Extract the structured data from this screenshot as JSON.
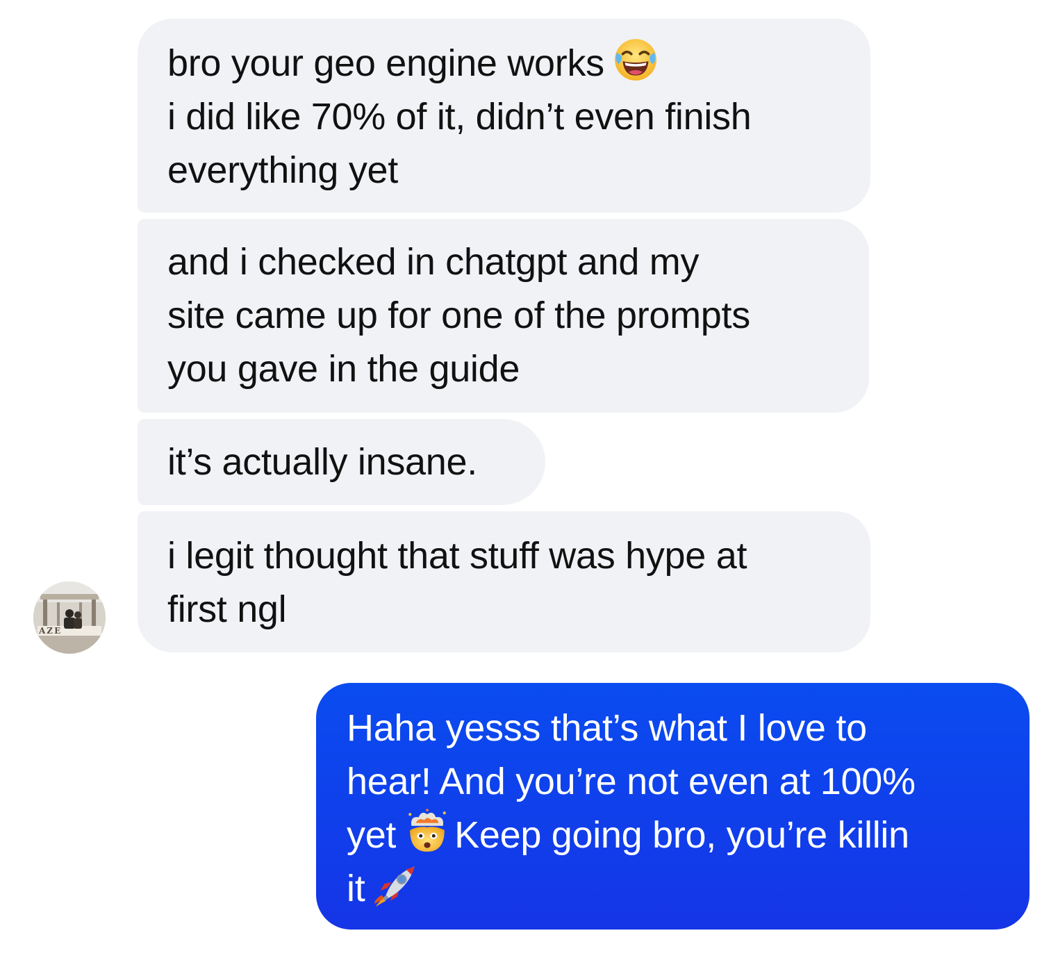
{
  "conversation": {
    "incoming_messages": [
      {
        "lines": [
          "bro your geo engine works",
          "i did like 70% of it, didn’t even finish",
          "everything yet"
        ],
        "emoji": "tears-of-joy-emoji"
      },
      {
        "lines": [
          "and i checked in chatgpt and my",
          "site came up for one of the prompts",
          "you gave in the guide"
        ]
      },
      {
        "lines": [
          "it’s actually insane."
        ]
      },
      {
        "lines": [
          "i legit thought that stuff was hype at",
          "first ngl"
        ]
      }
    ],
    "outgoing_message": {
      "line1": "Haha yesss that’s what I love to",
      "line2": "hear! And you’re not even at 100%",
      "line3_a": "yet",
      "line3_b": "Keep going bro, you’re killin",
      "line4": "it",
      "emojis": [
        "exploding-head-emoji",
        "rocket-emoji"
      ]
    },
    "avatar": {
      "text": "AZE"
    }
  },
  "colors": {
    "incoming_bubble": "#f1f2f6",
    "incoming_text": "#111111",
    "outgoing_bubble": "#0a4cf0",
    "outgoing_text": "#ffffff",
    "background": "#ffffff"
  }
}
